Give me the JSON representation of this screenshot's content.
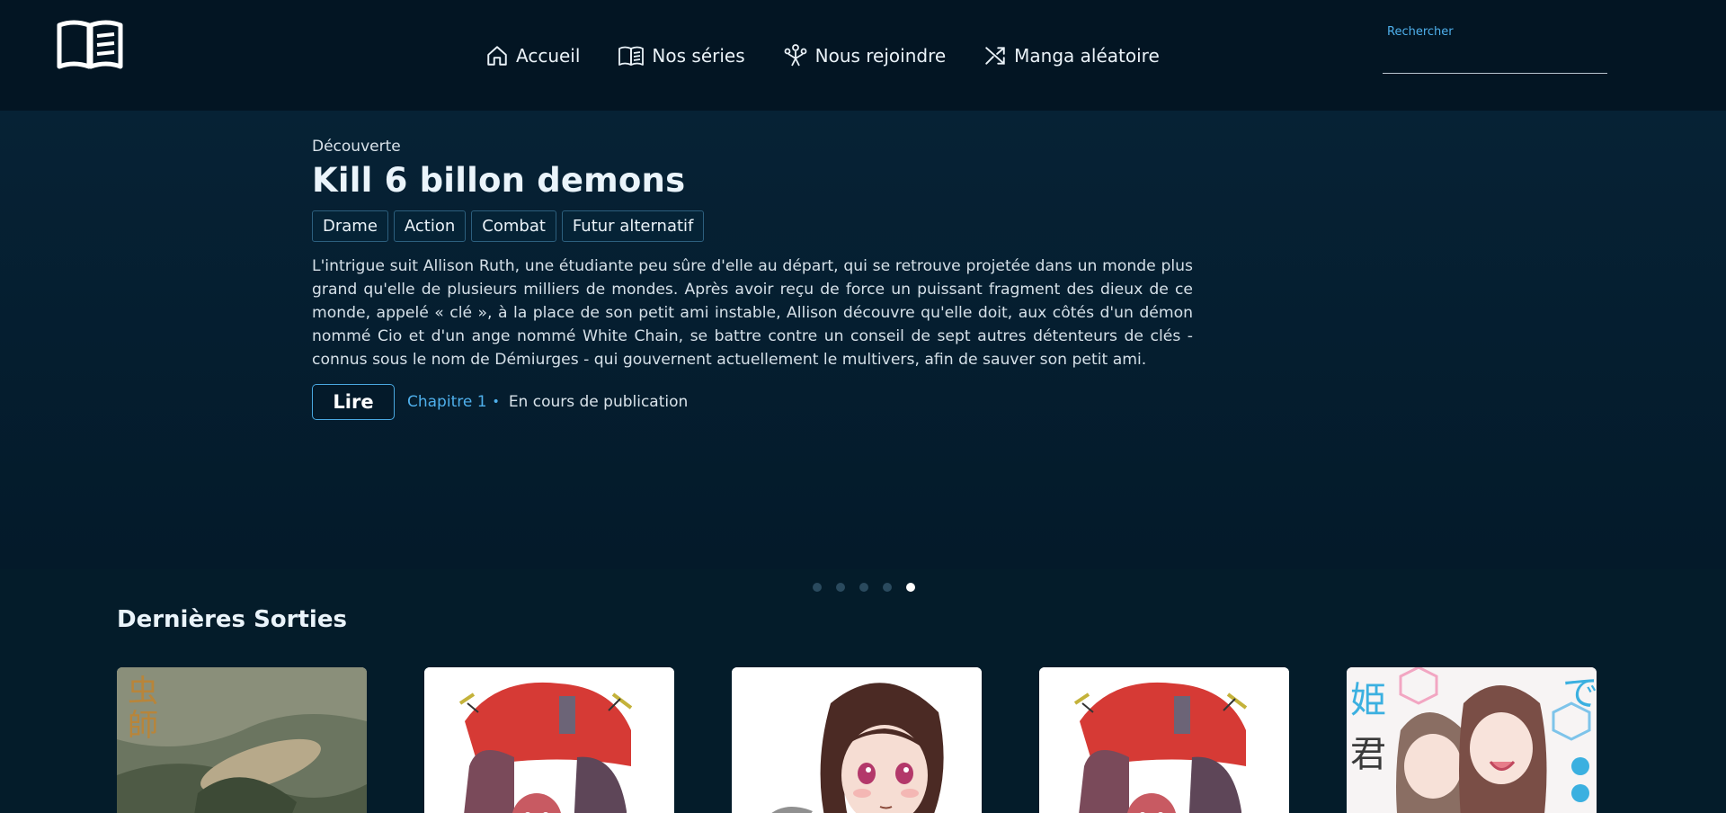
{
  "header": {
    "logo_icon": "open-book-icon",
    "nav": [
      {
        "label": "Accueil",
        "icon": "home-icon"
      },
      {
        "label": "Nos séries",
        "icon": "book-icon"
      },
      {
        "label": "Nous rejoindre",
        "icon": "group-icon"
      },
      {
        "label": "Manga aléatoire",
        "icon": "shuffle-icon"
      }
    ],
    "search": {
      "label": "Rechercher",
      "value": ""
    }
  },
  "hero": {
    "eyebrow": "Découverte",
    "title": "Kill 6 billon demons",
    "tags": [
      "Drame",
      "Action",
      "Combat",
      "Futur alternatif"
    ],
    "description": "L'intrigue suit Allison Ruth, une étudiante peu sûre d'elle au départ, qui se retrouve projetée dans un monde plus grand qu'elle de plusieurs milliers de mondes. Après avoir reçu de force un puissant fragment des dieux de ce monde, appelé « clé », à la place de son petit ami instable, Allison découvre qu'elle doit, aux côtés d'un démon nommé Cio et d'un ange nommé White Chain, se battre contre un conseil de sept autres détenteurs de clés - connus sous le nom de Démiurges - qui gouvernent actuellement le multivers, afin de sauver son petit ami.",
    "read_label": "Lire",
    "chapter": "Chapitre 1",
    "separator": "•",
    "status": "En cours de publication"
  },
  "carousel": {
    "count": 5,
    "active": 5
  },
  "latest": {
    "title": "Dernières Sorties",
    "cards": [
      {
        "cover": "mushishi-cover"
      },
      {
        "cover": "red-demon-cover"
      },
      {
        "cover": "girl-portrait-cover"
      },
      {
        "cover": "red-demon-cover"
      },
      {
        "cover": "two-girls-cover"
      }
    ]
  },
  "colors": {
    "accent": "#4fb0ec",
    "background": "#041c2a",
    "header": "#031523"
  }
}
